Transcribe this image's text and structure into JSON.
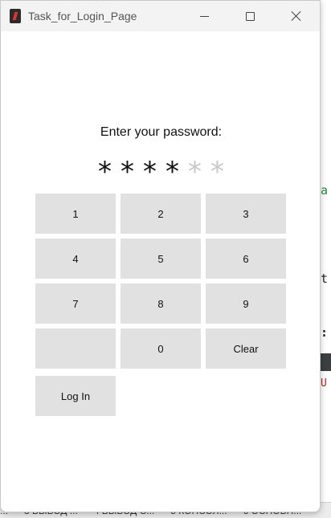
{
  "window": {
    "title": "Task_for_Login_Page",
    "controls": {
      "minimize_icon": "minimize-icon",
      "maximize_icon": "maximize-icon",
      "close_icon": "close-icon"
    }
  },
  "prompt": "Enter your password:",
  "pin": {
    "filled_char": "*",
    "empty_char": "*",
    "filled_count": 4,
    "total_count": 6,
    "colors": {
      "filled": "#111111",
      "empty": "#c8c8c8"
    }
  },
  "keypad": {
    "k1": "1",
    "k2": "2",
    "k3": "3",
    "k4": "4",
    "k5": "5",
    "k6": "6",
    "k7": "7",
    "k8": "8",
    "k9": "9",
    "blank": "",
    "k0": "0",
    "clear": "Clear",
    "login": "Log In"
  },
  "taskbar": {
    "items": [
      "...",
      "3 ВЫВОД ...",
      "4 ВЫВОД С...",
      "5 КОНСОЛ...",
      "6 ОСНОВН..."
    ]
  },
  "colors": {
    "key_bg": "#e1e1e1",
    "window_bg": "#ffffff",
    "titlebar_bg": "#f3f3f3"
  }
}
